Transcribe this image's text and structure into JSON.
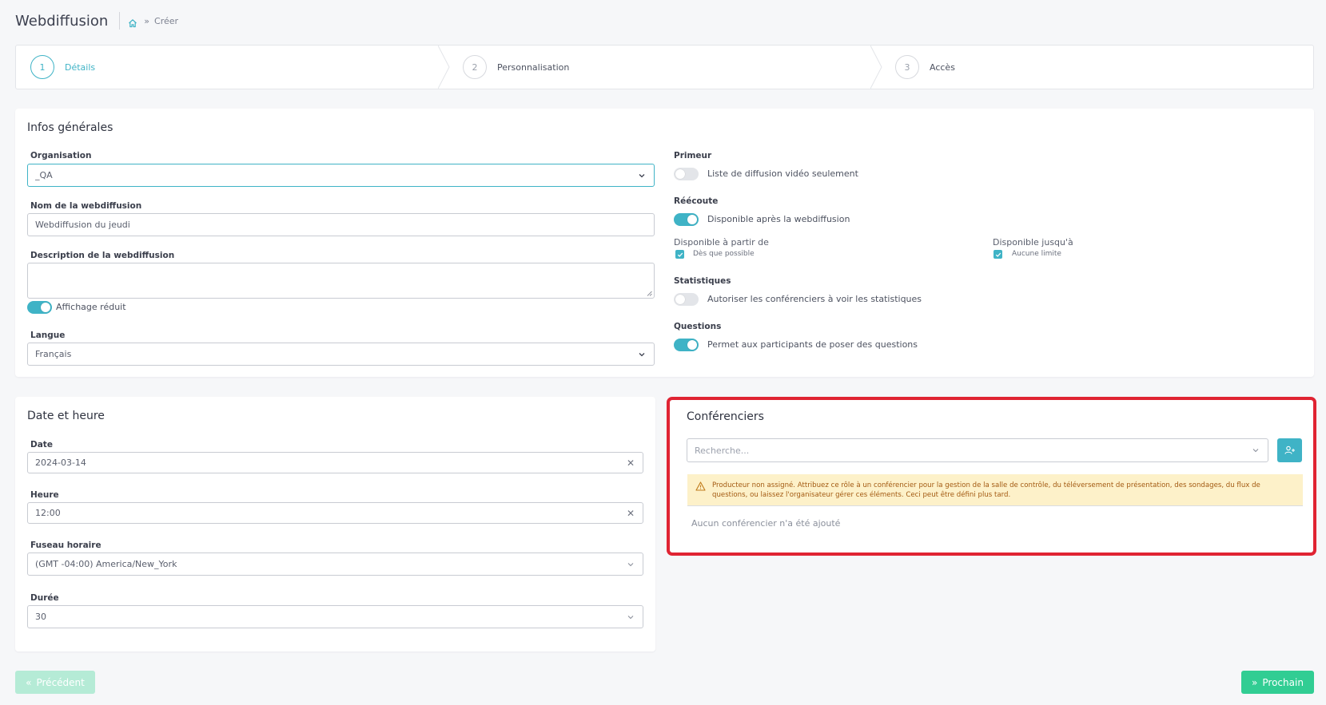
{
  "header": {
    "title": "Webdiffusion",
    "breadcrumb_current": "Créer",
    "breadcrumb_sep": "»"
  },
  "stepper": {
    "steps": [
      {
        "number": "1",
        "label": "Détails",
        "active": true
      },
      {
        "number": "2",
        "label": "Personnalisation",
        "active": false
      },
      {
        "number": "3",
        "label": "Accès",
        "active": false
      }
    ]
  },
  "infos": {
    "title": "Infos générales",
    "organisation": {
      "label": "Organisation",
      "value": "_QA"
    },
    "name": {
      "label": "Nom de la webdiffusion",
      "value": "Webdiffusion du jeudi"
    },
    "description": {
      "label": "Description de la webdiffusion",
      "value": ""
    },
    "compact_view": {
      "label": "Affichage réduit",
      "on": true
    },
    "language": {
      "label": "Langue",
      "value": "Français"
    },
    "premiere": {
      "label": "Primeur",
      "toggle_label": "Liste de diffusion vidéo seulement",
      "on": false
    },
    "replay": {
      "label": "Réécoute",
      "toggle_label": "Disponible après la webdiffusion",
      "on": true,
      "from_label": "Disponible à partir de",
      "from_check": "Dès que possible",
      "until_label": "Disponible jusqu'à",
      "until_check": "Aucune limite"
    },
    "stats": {
      "label": "Statistiques",
      "toggle_label": "Autoriser les conférenciers à voir les statistiques",
      "on": false
    },
    "questions": {
      "label": "Questions",
      "toggle_label": "Permet aux participants de poser des questions",
      "on": true
    }
  },
  "datetime": {
    "title": "Date et heure",
    "date": {
      "label": "Date",
      "value": "2024-03-14"
    },
    "time": {
      "label": "Heure",
      "value": "12:00"
    },
    "timezone": {
      "label": "Fuseau horaire",
      "value": "(GMT -04:00) America/New_York"
    },
    "duration": {
      "label": "Durée",
      "value": "30"
    }
  },
  "speakers": {
    "title": "Conférenciers",
    "search_placeholder": "Recherche...",
    "warning": "Producteur non assigné. Attribuez ce rôle à un conférencier pour la gestion de la salle de contrôle, du téléversement de présentation, des sondages, du flux de questions, ou laissez l'organisateur gérer ces éléments. Ceci peut être défini plus tard.",
    "empty": "Aucun conférencier n'a été ajouté"
  },
  "footer": {
    "prev_label": "Précédent",
    "next_label": "Prochain",
    "prev_arrow": "«",
    "next_arrow": "»"
  },
  "colors": {
    "accent": "#3fb3c6",
    "success": "#31cd93",
    "success_disabled": "#b5ebd6",
    "highlight": "#e02433",
    "warning_bg": "#fdf1c9",
    "warning_text": "#a35a12"
  }
}
